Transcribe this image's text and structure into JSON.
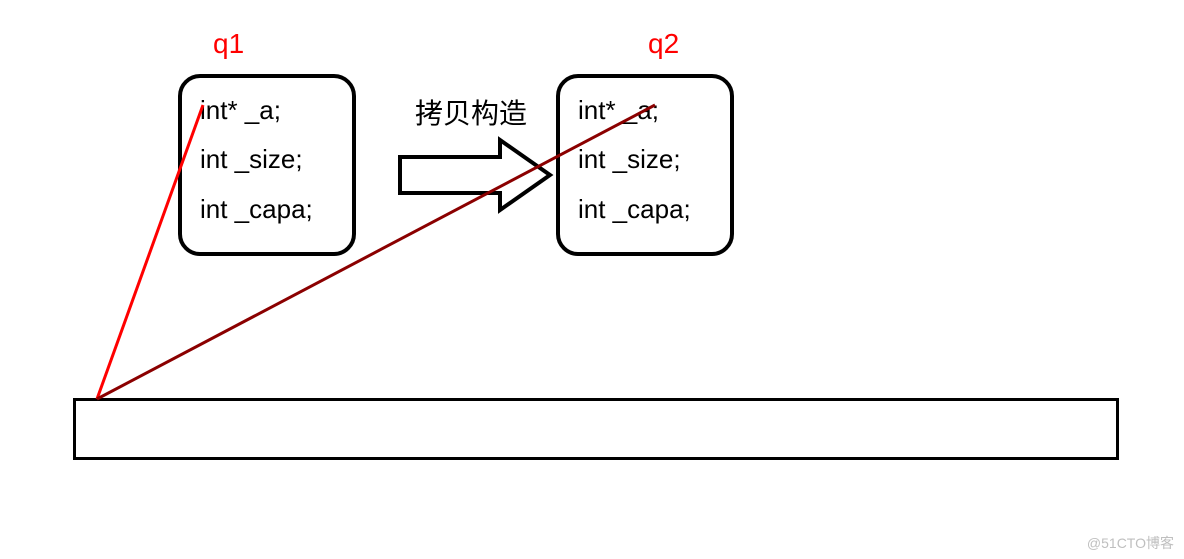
{
  "labels": {
    "q1": "q1",
    "q2": "q2",
    "copy": "拷贝构造"
  },
  "box1": {
    "line1": "int* _a;",
    "line2": "int _size;",
    "line3": "int _capa;"
  },
  "box2": {
    "line1": "int* _a;",
    "line2": "int _size;",
    "line3": "int _capa;"
  },
  "watermark": "@51CTO博客"
}
